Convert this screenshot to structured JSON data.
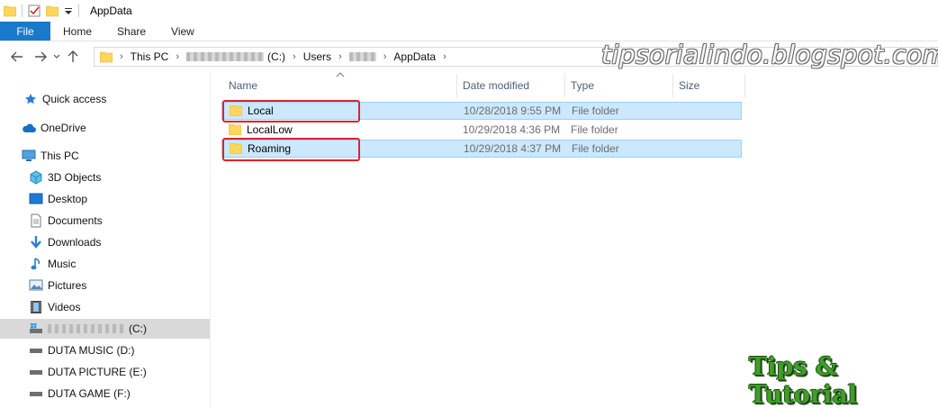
{
  "window": {
    "title": "AppData"
  },
  "ribbon": {
    "tabs": [
      "File",
      "Home",
      "Share",
      "View"
    ]
  },
  "address": {
    "crumbs": [
      "This PC",
      "(C:)",
      "Users",
      "AppData"
    ]
  },
  "watermark": "tipsorialindo.blogspot.com",
  "sidebar": {
    "quick_access": "Quick access",
    "onedrive": "OneDrive",
    "this_pc": "This PC",
    "items": [
      "3D Objects",
      "Desktop",
      "Documents",
      "Downloads",
      "Music",
      "Pictures",
      "Videos"
    ],
    "drive_c_suffix": "(C:)",
    "drives": [
      "DUTA MUSIC (D:)",
      "DUTA PICTURE (E:)",
      "DUTA GAME (F:)"
    ]
  },
  "columns": {
    "name": "Name",
    "date": "Date modified",
    "type": "Type",
    "size": "Size"
  },
  "files": [
    {
      "name": "Local",
      "date": "10/28/2018 9:55 PM",
      "type": "File folder"
    },
    {
      "name": "LocalLow",
      "date": "10/29/2018 4:36 PM",
      "type": "File folder"
    },
    {
      "name": "Roaming",
      "date": "10/29/2018 4:37 PM",
      "type": "File folder"
    }
  ],
  "logo": "Tips & Tutorial",
  "colors": {
    "file_tab": "#1979ca",
    "selection": "#cce8ff",
    "highlight": "#e0232b",
    "folder": "#ffd65c"
  }
}
